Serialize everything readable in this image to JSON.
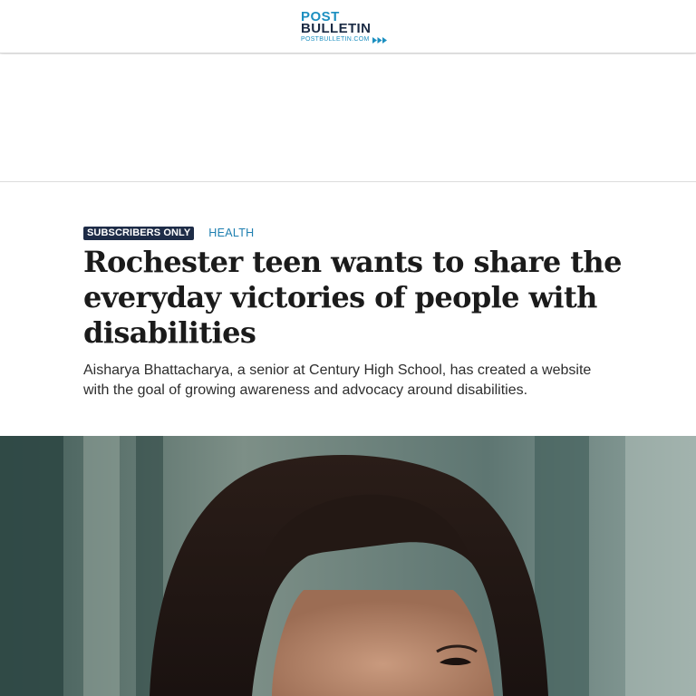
{
  "header": {
    "logo": {
      "line1": "POST",
      "line2": "BULLETIN",
      "url": "POSTBULLETIN.COM",
      "icon": "triple-chevron-icon"
    }
  },
  "article": {
    "badge": "SUBSCRIBERS ONLY",
    "category": "HEALTH",
    "headline": "Rochester teen wants to share the everyday victories of people with disabilities",
    "dek": "Aisharya Bhattacharya, a senior at Century High School, has created a website with the goal of growing awareness and advocacy around disabilities."
  },
  "colors": {
    "brand_blue": "#1c8fc0",
    "brand_navy": "#1a2a44",
    "badge_bg": "#1e2c47",
    "category": "#1e7fb0"
  }
}
